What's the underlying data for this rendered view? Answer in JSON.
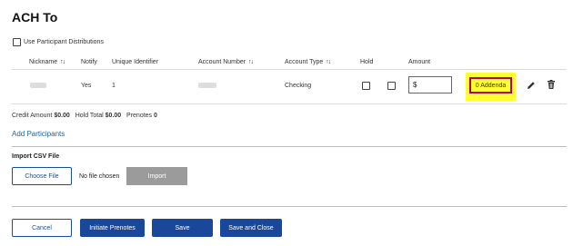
{
  "page": {
    "title": "ACH To"
  },
  "participant_distributions": {
    "label": "Use Participant Distributions",
    "checked": false
  },
  "table": {
    "headers": {
      "nickname": "Nickname",
      "notify": "Notify",
      "unique_identifier": "Unique Identifier",
      "account_number": "Account Number",
      "account_type": "Account Type",
      "hold": "Hold",
      "amount": "Amount"
    },
    "row": {
      "notify": "Yes",
      "unique_identifier": "1",
      "account_type": "Checking",
      "amount_prefix": "$",
      "addenda": "0 Addenda"
    }
  },
  "totals": {
    "credit_amount_label": "Credit Amount",
    "credit_amount_value": "$0.00",
    "hold_total_label": "Hold Total",
    "hold_total_value": "$0.00",
    "prenotes_label": "Prenotes",
    "prenotes_value": "0"
  },
  "add_participants": "Add Participants",
  "import_csv": {
    "title": "Import CSV File",
    "choose_file": "Choose File",
    "no_file": "No file chosen",
    "import_button": "Import"
  },
  "footer": {
    "cancel": "Cancel",
    "initiate_prenotes": "Initiate Prenotes",
    "save": "Save",
    "save_and_close": "Save and Close"
  },
  "colors": {
    "primary": "#19489b",
    "link": "#1565a6",
    "highlight": "#ffff33",
    "highlight_border": "#b0005c",
    "disabled": "#9b9b9b"
  },
  "icons": [
    "sort-icon",
    "pencil-icon",
    "trash-icon"
  ]
}
